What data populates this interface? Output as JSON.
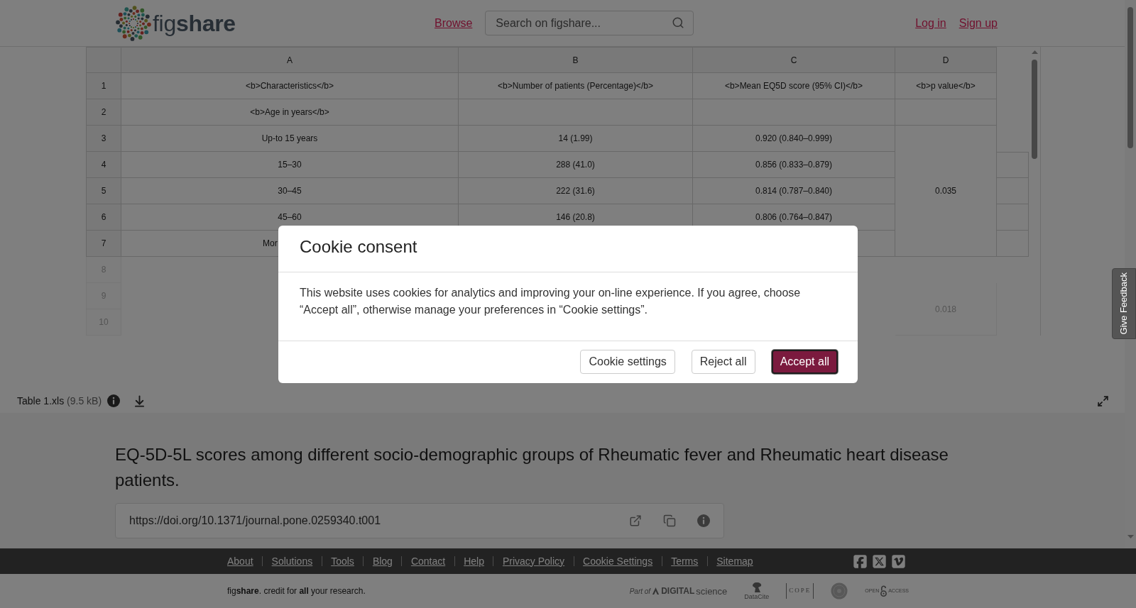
{
  "header": {
    "logo": "fig**share**",
    "nav_link": "Browse",
    "search": {
      "placeholder": "Search on figshare..."
    },
    "auth_links": [
      "Log in",
      "Sign up"
    ]
  },
  "viewer": {
    "table": {
      "columns": [
        "A",
        "B",
        "C",
        "D"
      ],
      "rows": [
        {
          "number": "1",
          "cells": [
            {
              "text": "<b>Characteristics</b>"
            },
            {
              "text": "<b>Number of patients (Percentage)</b>"
            },
            {
              "text": "<b>Mean EQ5D score (95% CI)</b>"
            },
            {
              "text": "<b>p value</b>"
            }
          ]
        },
        {
          "number": "2",
          "cells": [
            {
              "text": "<b>Age in years</b>"
            },
            null,
            null,
            null
          ]
        },
        {
          "number": "3",
          "cells": [
            {
              "text": "Up-to 15 years"
            },
            {
              "text": "14 (1.99)"
            },
            {
              "text": "0.920 (0.840–0.999)"
            },
            null
          ]
        },
        {
          "number": "4",
          "cells": [
            {
              "text": "15–30"
            },
            {
              "text": "288 (41.0)"
            },
            {
              "text": "0.856 (0.833–0.879)"
            },
            {
              "merged_above": true
            },
            null
          ]
        },
        {
          "number": "5",
          "cells": [
            {
              "text": "30–45"
            },
            {
              "text": "222 (31.6)"
            },
            {
              "text": "0.814 (0.787–0.840)"
            },
            {
              "text": "0.035",
              "merged_above": true
            },
            null
          ]
        },
        {
          "number": "6",
          "cells": [
            {
              "text": "45–60"
            },
            {
              "text": "146 (20.8)"
            },
            {
              "text": "0.806 (0.764–0.847)"
            },
            {
              "merged_above": true
            },
            null
          ]
        },
        {
          "number": "7",
          "cells": [
            {
              "text": "Mor"
            },
            null,
            null,
            {
              "merged_above": true
            },
            null
          ]
        }
      ],
      "rows_fading": [
        {
          "number": "8",
          "cells": [
            null,
            null,
            null,
            null
          ]
        },
        {
          "number": "9",
          "cells": [
            null,
            null,
            null,
            {
              "text": "0.018"
            }
          ]
        },
        {
          "number": "10",
          "cells": [
            null,
            null,
            null,
            {
              "merged_above": true
            }
          ]
        }
      ]
    },
    "file": {
      "name": "Table 1.xls",
      "size": "(9.5 kB)"
    }
  },
  "item": {
    "title": "EQ-5D-5L scores among different socio-demographic groups of Rheumatic fever and Rheumatic heart disease patients.",
    "doi": "https://doi.org/10.1371/journal.pone.0259340.t001"
  },
  "footer": {
    "links": [
      "About",
      "Solutions",
      "Tools",
      "Blog",
      "Contact",
      "Help",
      "Privacy Policy",
      "Cookie Settings",
      "Terms",
      "Sitemap"
    ],
    "tagline": "fig**share**. credit for **all** your research.",
    "partners": [
      {
        "kind": "digital_science",
        "prefix": "Part of",
        "name": "DIGITAL",
        "suffix": "science"
      },
      {
        "kind": "datacite",
        "name": "DataCite"
      },
      {
        "kind": "cope",
        "name": "COPE"
      },
      {
        "kind": "seal"
      },
      {
        "kind": "open_access",
        "name": "OPEN",
        "suffix": "ACCESS"
      }
    ]
  },
  "feedback_tab": "Give Feedback",
  "cookie_dialog": {
    "title": "Cookie consent",
    "text": "This website uses cookies for analytics and improving your on-line experience. If you agree, choose “Accept all”, otherwise manage your preferences in “Cookie settings”.",
    "buttons": [
      {
        "label": "Cookie settings",
        "kind": "secondary",
        "focused": false
      },
      {
        "label": "Reject all",
        "kind": "secondary",
        "focused": false
      },
      {
        "label": "Accept all",
        "kind": "primary",
        "focused": true
      }
    ]
  }
}
